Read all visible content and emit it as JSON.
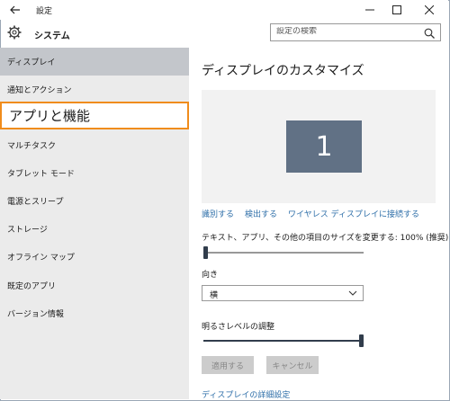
{
  "window": {
    "title": "設定",
    "back_icon": "back-arrow-icon",
    "minimize_icon": "minimize-icon",
    "maximize_icon": "maximize-icon",
    "close_icon": "close-icon"
  },
  "header": {
    "icon": "gear-icon",
    "title": "システム",
    "search_placeholder": "設定の検索",
    "search_icon": "search-icon"
  },
  "sidebar": {
    "items": [
      {
        "label": "ディスプレイ",
        "state": "selected"
      },
      {
        "label": "通知とアクション"
      },
      {
        "label": "アプリと機能",
        "state": "highlighted"
      },
      {
        "label": "マルチタスク"
      },
      {
        "label": "タブレット モード"
      },
      {
        "label": "電源とスリープ"
      },
      {
        "label": "ストレージ"
      },
      {
        "label": "オフライン マップ"
      },
      {
        "label": "既定のアプリ"
      },
      {
        "label": "バージョン情報"
      }
    ]
  },
  "main": {
    "title": "ディスプレイのカスタマイズ",
    "monitor_number": "1",
    "links": {
      "identify": "識別する",
      "detect": "検出する",
      "wireless": "ワイヤレス ディスプレイに接続する"
    },
    "scale": {
      "label": "テキスト、アプリ、その他の項目のサイズを変更する: 100% (推奨)",
      "value_percent": 100,
      "slider_fraction": 0.0
    },
    "orientation": {
      "label": "向き",
      "selected": "横"
    },
    "brightness": {
      "label": "明るさレベルの調整",
      "slider_fraction": 1.0
    },
    "buttons": {
      "apply": "適用する",
      "cancel": "キャンセル"
    },
    "advanced_link": "ディスプレイの詳細設定"
  },
  "colors": {
    "accent_link": "#2d6ea8",
    "highlight_border": "#f08c1c",
    "monitor_fill": "#617185",
    "sidebar_bg": "#ebebeb",
    "selected_bg": "#c3c6cb"
  }
}
